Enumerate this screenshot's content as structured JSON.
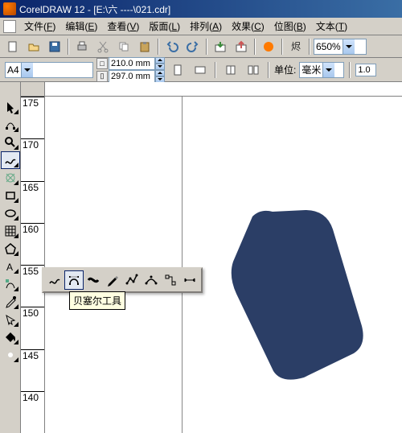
{
  "title": "CorelDRAW 12 - [E:\\六 ----\\021.cdr]",
  "menu": [
    {
      "label": "文件",
      "u": "F"
    },
    {
      "label": "编辑",
      "u": "E"
    },
    {
      "label": "查看",
      "u": "V"
    },
    {
      "label": "版面",
      "u": "L"
    },
    {
      "label": "排列",
      "u": "A"
    },
    {
      "label": "效果",
      "u": "C"
    },
    {
      "label": "位图",
      "u": "B"
    },
    {
      "label": "文本",
      "u": "T"
    }
  ],
  "zoom": "650%",
  "paper": "A4",
  "dims": {
    "w": "210.0 mm",
    "h": "297.0 mm"
  },
  "units_label": "单位:",
  "units_value": "毫米",
  "dup_offset": "1.0",
  "ruler_v_ticks": [
    "175",
    "170",
    "165",
    "160",
    "155",
    "150",
    "145",
    "140"
  ],
  "tooltip": "贝塞尔工具",
  "shape_fill": "#2b3e66",
  "tools": [
    "pick",
    "shape",
    "zoom",
    "freehand",
    "smart",
    "rect",
    "ellipse",
    "graph",
    "poly",
    "text",
    "interactive",
    "eyedrop",
    "outline",
    "fill",
    "ifill"
  ],
  "flyout_tools": [
    "freehand",
    "bezier",
    "artistic",
    "pen",
    "polyline",
    "3ptcurve",
    "connector",
    "dimension"
  ]
}
